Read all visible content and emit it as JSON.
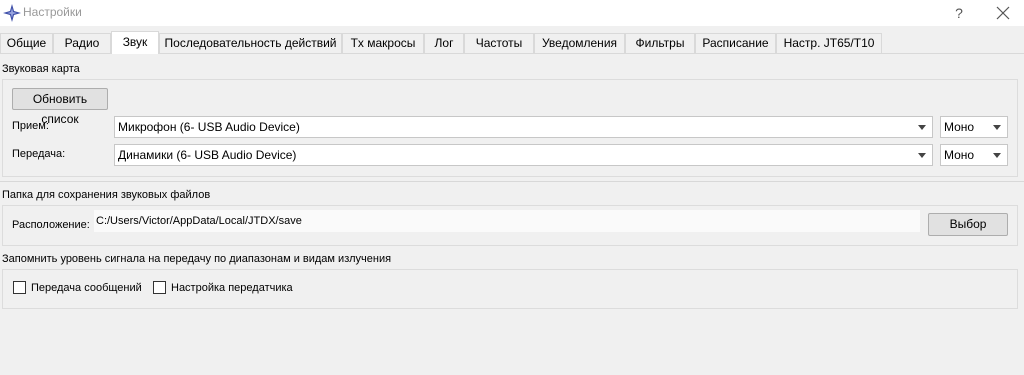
{
  "window": {
    "title": "Настройки",
    "help_label": "?",
    "icon": "compass-star-icon",
    "accent": "#3d4ea8"
  },
  "tabs": [
    {
      "label": "Общие",
      "active": false
    },
    {
      "label": "Радио",
      "active": false
    },
    {
      "label": "Звук",
      "active": true
    },
    {
      "label": "Последовательность действий",
      "active": false
    },
    {
      "label": "Tx макросы",
      "active": false
    },
    {
      "label": "Лог",
      "active": false
    },
    {
      "label": "Частоты",
      "active": false
    },
    {
      "label": "Уведомления",
      "active": false
    },
    {
      "label": "Фильтры",
      "active": false
    },
    {
      "label": "Расписание",
      "active": false
    },
    {
      "label": "Настр. JT65/T10",
      "active": false
    }
  ],
  "soundcard": {
    "title": "Звуковая карта",
    "refresh_label": "Обновить список",
    "input_label": "Прием:",
    "input_device": "Микрофон (6- USB Audio Device)",
    "input_channel": "Моно",
    "output_label": "Передача:",
    "output_device": "Динамики (6- USB Audio Device)",
    "output_channel": "Моно"
  },
  "save_folder": {
    "title": "Папка для сохранения звуковых файлов",
    "location_label": "Расположение:",
    "path": "C:/Users/Victor/AppData/Local/JTDX/save",
    "browse_label": "Выбор"
  },
  "remember_levels": {
    "title": "Запомнить уровень сигнала на передачу по диапазонам и видам излучения",
    "tx_messages_label": "Передача сообщений",
    "tx_messages_checked": false,
    "tune_label": "Настройка передатчика",
    "tune_checked": false
  }
}
